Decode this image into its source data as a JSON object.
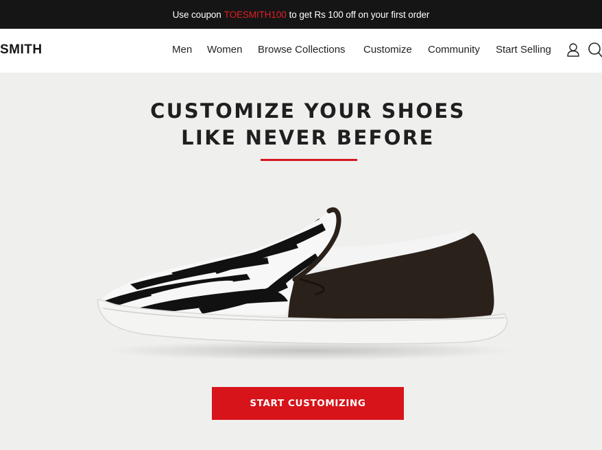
{
  "announcement": {
    "prefix": "Use coupon",
    "coupon_code": "TOESMITH100",
    "suffix": "to get Rs 100 off on your first order"
  },
  "header": {
    "logo_text": "SMITH",
    "menu": [
      {
        "label": "Men"
      },
      {
        "label": "Women"
      },
      {
        "label": "Browse Collections"
      },
      {
        "label": "Customize"
      },
      {
        "label": "Community"
      },
      {
        "label": "Start Selling"
      }
    ],
    "icons": [
      "user-icon",
      "search-icon"
    ]
  },
  "hero": {
    "title_line1": "CUSTOMIZE YOUR SHOES",
    "title_line2": "LIKE NEVER BEFORE",
    "cta_label": "START CUSTOMIZING"
  },
  "colors": {
    "accent": "#d7141a",
    "topbar_bg": "#151515",
    "hero_bg": "#efefee"
  }
}
